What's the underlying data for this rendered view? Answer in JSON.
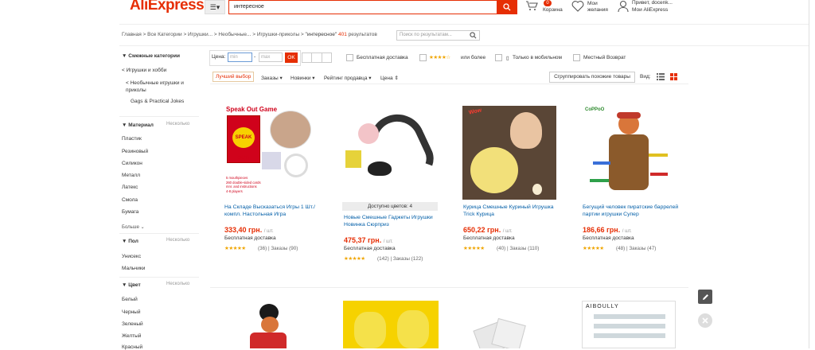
{
  "header": {
    "logo": "AliExpress",
    "search_value": "интересное",
    "cart_count": "0",
    "cart_label": "Корзина",
    "wishlist_label": "Мои\nжелания",
    "user_greeting": "Привет, docenk...",
    "user_account": "Мои AliExpress"
  },
  "breadcrumb": {
    "path": "Главная > Все Категории > Игрушки... > Необычные... > Игрушки-приколы > ",
    "query": "\"интересное\"",
    "count": "401",
    "results_word": "результатов",
    "in_results_placeholder": "Поиск по результатам..."
  },
  "sidebar": {
    "related_title": "Смежные категории",
    "related": [
      "< Игрушки и хобби",
      "< Необычные игрушки и приколы",
      "Gags & Practical Jokes"
    ],
    "material_title": "Материал",
    "material_more": "Несколько",
    "materials": [
      "Пластик",
      "Резиновый",
      "Силикон",
      "Металл",
      "Латекс",
      "Смола",
      "Бумага"
    ],
    "more_label": "Больше",
    "gender_title": "Пол",
    "gender_more": "Несколько",
    "genders": [
      "Унисекс",
      "Мальчики"
    ],
    "color_title": "Цвет",
    "color_more": "Несколько",
    "colors": [
      "Белый",
      "Черный",
      "Зеленый",
      "Желтый",
      "Красный"
    ]
  },
  "filters": {
    "price_label": "Цена:",
    "min_placeholder": "min",
    "max_placeholder": "max",
    "ok": "OK",
    "free_shipping": "Бесплатная доставка",
    "rating_suffix": "или более",
    "mobile_only": "Только в мобильном",
    "local_return": "Местный Возврат"
  },
  "sort": {
    "best": "Лучший выбор",
    "orders": "Заказы",
    "newest": "Новинки",
    "seller_rating": "Рейтинг продавца",
    "price": "Цена",
    "group_similar": "Сгруппировать похожие товары",
    "view_label": "Вид:"
  },
  "products": [
    {
      "title": "На Складе Высказаться Игры 1 Шт./компл. Настольная Игра",
      "price": "333,40 грн.",
      "unit": "/ шт.",
      "shipping": "Бесплатная доставка",
      "rating_count": "(36)",
      "orders": "Заказы (90)",
      "box_title": "Speak Out Game",
      "box_note": "5 mouthpieces\n260 double-sided cards\nmnr. and instructions\n4-8 players"
    },
    {
      "title": "Новые Смешные Гаджеты Игрушки Новинка Сюрприз",
      "price": "475,37 грн.",
      "unit": "/ шт.",
      "shipping": "Бесплатная доставка",
      "rating_count": "(142)",
      "orders": "Заказы (122)",
      "colors_available": "Доступно цветов: 4"
    },
    {
      "title": "Курица Смешные Куриный Игрушка Trick Курица",
      "price": "650,22 грн.",
      "unit": "/ шт.",
      "shipping": "Бесплатная доставка",
      "rating_count": "(40)",
      "orders": "Заказы (110)",
      "image_text": "Wow"
    },
    {
      "title": "Бегущий человек пиратские баррелей партии игрушки Супер",
      "price": "186,66 грн.",
      "unit": "/ шт.",
      "shipping": "Бесплатная доставка",
      "rating_count": "(48)",
      "orders": "Заказы (47)",
      "brand_text": "CoPPoO"
    }
  ],
  "row2": {
    "brand_text": "AIBOULLY"
  },
  "icons": [
    "menu-icon",
    "search-icon",
    "cart-icon",
    "heart-icon",
    "user-icon",
    "star-icon",
    "mobile-icon",
    "list-view-icon",
    "grid-view-icon",
    "edit-icon",
    "close-icon"
  ],
  "colors": {
    "accent": "#e62e04",
    "link": "#035fa8",
    "star": "#f0a500"
  }
}
